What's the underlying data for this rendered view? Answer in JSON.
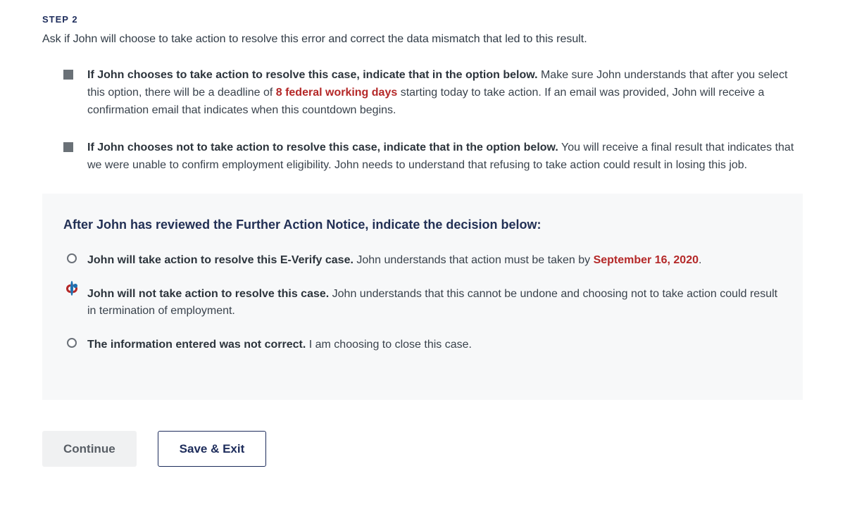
{
  "step": {
    "label": "STEP 2",
    "intro": "Ask if John will choose to take action to resolve this error and correct the data mismatch that led to this result."
  },
  "bullets": [
    {
      "bold": "If John chooses to take action to resolve this case, indicate that in the option below.",
      "tail_pre": " Make sure John understands that after you select this option, there will be a deadline of ",
      "highlight": "8 federal working days",
      "tail_post": " starting today to take action. If an email was provided, John will receive a confirmation email that indicates when this countdown begins."
    },
    {
      "bold": "If John chooses not to take action to resolve this case, indicate that in the option below.",
      "tail_pre": " You will receive a final result that indicates that we were unable to confirm employment eligibility. John needs to understand that refusing to take action could result in losing this job.",
      "highlight": "",
      "tail_post": ""
    }
  ],
  "decision": {
    "heading": "After John has reviewed the Further Action Notice, indicate the decision below:",
    "options": [
      {
        "bold": "John will take action to resolve this E-Verify case.",
        "tail_pre": " John understands that action must be taken by ",
        "highlight": "September 16, 2020",
        "tail_post": ".",
        "selected": false
      },
      {
        "bold": "John will not take action to resolve this case.",
        "tail_pre": " John understands that this cannot be undone and choosing not to take action could result in termination of employment.",
        "highlight": "",
        "tail_post": "",
        "selected": true
      },
      {
        "bold": "The information entered was not correct.",
        "tail_pre": " I am choosing to close this case.",
        "highlight": "",
        "tail_post": "",
        "selected": false
      }
    ]
  },
  "buttons": {
    "continue": "Continue",
    "save_exit": "Save & Exit"
  }
}
